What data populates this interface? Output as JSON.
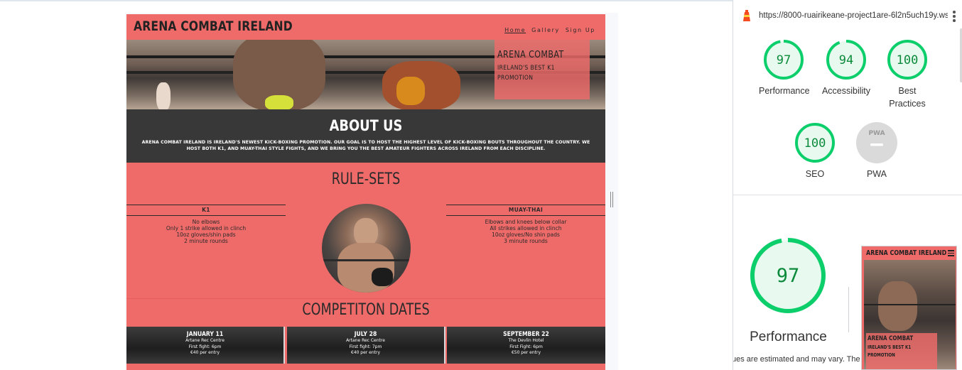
{
  "preview": {
    "site": {
      "logo": "ARENA COMBAT IRELAND",
      "nav": [
        {
          "label": "Home",
          "active": true
        },
        {
          "label": "Gallery",
          "active": false
        },
        {
          "label": "Sign Up",
          "active": false
        }
      ],
      "hero": {
        "title": "ARENA COMBAT",
        "subtitle": "IRELAND'S BEST K1 PROMOTION"
      },
      "about": {
        "title": "ABOUT US",
        "text": "ARENA COMBAT IRELAND IS IRELAND'S NEWEST KICK-BOXING PROMOTION. OUR GOAL IS TO HOST THE HIGHEST LEVEL OF KICK-BOXING BOUTS THROUGHOUT THE COUNTRY. WE HOST BOTH K1, AND MUAY-THAI STYLE FIGHTS, AND WE BRING YOU THE BEST AMATEUR FIGHTERS ACROSS IRELAND FROM EACH DISCIPLINE."
      },
      "rulesets": {
        "title": "RULE-SETS",
        "k1": {
          "heading": "K1",
          "rules": [
            "No elbows",
            "Only 1 strike allowed in clinch",
            "10oz gloves/shin pads",
            "2 minute rounds"
          ]
        },
        "muaythai": {
          "heading": "MUAY-THAI",
          "rules": [
            "Elbows and knees below collar",
            "All strikes allowed in clinch",
            "10oz gloves/No shin pads",
            "3 minute rounds"
          ]
        }
      },
      "dates": {
        "title": "COMPETITON DATES",
        "events": [
          {
            "date": "JANUARY 11",
            "venue": "Artane Rec Centre",
            "first_fight": "First fight: 6pm",
            "price": "€40 per entry"
          },
          {
            "date": "JULY 28",
            "venue": "Artane Rec Centre",
            "first_fight": "First fight: 7pm",
            "price": "€40 per entry"
          },
          {
            "date": "SEPTEMBER 22",
            "venue": "The Devlin Hotel",
            "first_fight": "First Fight: 6pm",
            "price": "€50 per entry"
          }
        ]
      }
    }
  },
  "lighthouse": {
    "url": "https://8000-ruairikeane-project1are-6l2n5uch19y.ws...",
    "scores": [
      {
        "label": "Performance",
        "score": "97",
        "value": 97
      },
      {
        "label": "Accessibility",
        "score": "94",
        "value": 94
      },
      {
        "label": "Best Practices",
        "score": "100",
        "value": 100
      },
      {
        "label": "SEO",
        "score": "100",
        "value": 100
      },
      {
        "label": "PWA",
        "score": "PWA",
        "value": null
      }
    ],
    "main": {
      "score": "97",
      "value": 97,
      "label": "Performance",
      "note": "ues are estimated and may vary. The"
    },
    "thumbnail": {
      "logo": "ARENA COMBAT IRELAND",
      "title": "ARENA COMBAT",
      "subtitle": "IRELAND'S BEST K1 PROMOTION"
    },
    "colors": {
      "pass": "#0cce6b",
      "pass_fill": "#e8faef",
      "pass_text": "#0a8a3a",
      "pwa_gray": "#d9d9d9"
    }
  }
}
